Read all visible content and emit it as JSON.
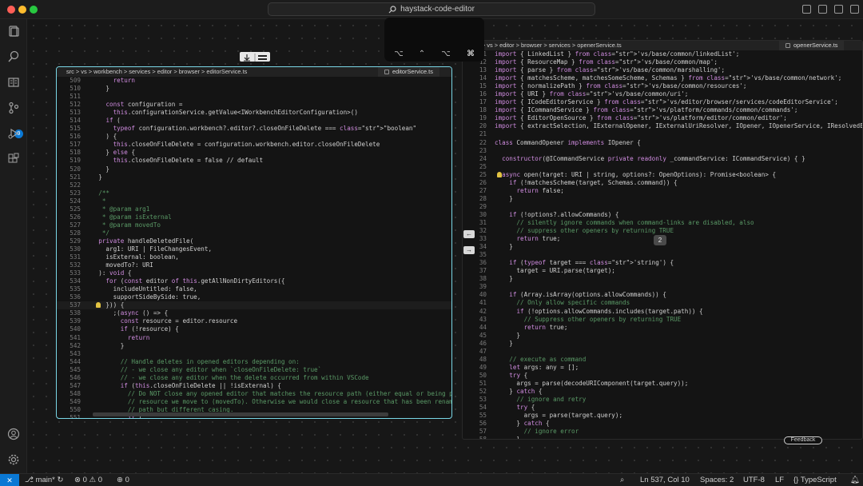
{
  "titlebar": {
    "search_text": "haystack-code-editor"
  },
  "activity": {
    "source_control_badge": "9"
  },
  "left_editor": {
    "breadcrumb": "src > vs > workbench > services > editor > browser > editorService.ts",
    "tab": "editorService.ts",
    "lines": [
      {
        "n": "509",
        "t": "        return"
      },
      {
        "n": "510",
        "t": "      }"
      },
      {
        "n": "511",
        "t": ""
      },
      {
        "n": "512",
        "t": "      const configuration ="
      },
      {
        "n": "513",
        "t": "        this.configurationService.getValue<IWorkbenchEditorConfiguration>()"
      },
      {
        "n": "514",
        "t": "      if ("
      },
      {
        "n": "515",
        "t": "        typeof configuration.workbench?.editor?.closeOnFileDelete === \"boolean\""
      },
      {
        "n": "516",
        "t": "      ) {"
      },
      {
        "n": "517",
        "t": "        this.closeOnFileDelete = configuration.workbench.editor.closeOnFileDelete"
      },
      {
        "n": "518",
        "t": "      } else {"
      },
      {
        "n": "519",
        "t": "        this.closeOnFileDelete = false // default"
      },
      {
        "n": "520",
        "t": "      }"
      },
      {
        "n": "521",
        "t": "    }"
      },
      {
        "n": "522",
        "t": ""
      },
      {
        "n": "523",
        "t": "    /**"
      },
      {
        "n": "524",
        "t": "     *"
      },
      {
        "n": "525",
        "t": "     * @param arg1"
      },
      {
        "n": "526",
        "t": "     * @param isExternal"
      },
      {
        "n": "527",
        "t": "     * @param movedTo"
      },
      {
        "n": "528",
        "t": "     */"
      },
      {
        "n": "529",
        "t": "    private handleDeletedFile("
      },
      {
        "n": "530",
        "t": "      arg1: URI | FileChangesEvent,"
      },
      {
        "n": "531",
        "t": "      isExternal: boolean,"
      },
      {
        "n": "532",
        "t": "      movedTo?: URI"
      },
      {
        "n": "533",
        "t": "    ): void {"
      },
      {
        "n": "534",
        "t": "      for (const editor of this.getAllNonDirtyEditors({"
      },
      {
        "n": "535",
        "t": "        includeUntitled: false,"
      },
      {
        "n": "536",
        "t": "        supportSideBySide: true,"
      },
      {
        "n": "537",
        "t": "      })) {"
      },
      {
        "n": "538",
        "t": "        ;(async () => {"
      },
      {
        "n": "539",
        "t": "          const resource = editor.resource"
      },
      {
        "n": "540",
        "t": "          if (!resource) {"
      },
      {
        "n": "541",
        "t": "            return"
      },
      {
        "n": "542",
        "t": "          }"
      },
      {
        "n": "543",
        "t": ""
      },
      {
        "n": "544",
        "t": "          // Handle deletes in opened editors depending on:"
      },
      {
        "n": "545",
        "t": "          // - we close any editor when `closeOnFileDelete: true`"
      },
      {
        "n": "546",
        "t": "          // - we close any editor when the delete occurred from within VSCode"
      },
      {
        "n": "547",
        "t": "          if (this.closeOnFileDelete || !isExternal) {"
      },
      {
        "n": "548",
        "t": "            // Do NOT close any opened editor that matches the resource path (either equal or being pa"
      },
      {
        "n": "549",
        "t": "            // resource we move to (movedTo). Otherwise we would close a resource that has been rename"
      },
      {
        "n": "550",
        "t": "            // path but different casing."
      },
      {
        "n": "551",
        "t": "            if ("
      }
    ]
  },
  "right_editor": {
    "breadcrumb": "src > vs > editor > browser > services > openerService.ts",
    "tab": "openerService.ts",
    "lines": [
      {
        "n": "11",
        "t": "import { LinkedList } from 'vs/base/common/linkedList';"
      },
      {
        "n": "12",
        "t": "import { ResourceMap } from 'vs/base/common/map';"
      },
      {
        "n": "13",
        "t": "import { parse } from 'vs/base/common/marshalling';"
      },
      {
        "n": "14",
        "t": "import { matchesScheme, matchesSomeScheme, Schemas } from 'vs/base/common/network';"
      },
      {
        "n": "15",
        "t": "import { normalizePath } from 'vs/base/common/resources';"
      },
      {
        "n": "16",
        "t": "import { URI } from 'vs/base/common/uri';"
      },
      {
        "n": "17",
        "t": "import { ICodeEditorService } from 'vs/editor/browser/services/codeEditorService';"
      },
      {
        "n": "18",
        "t": "import { ICommandService } from 'vs/platform/commands/common/commands';"
      },
      {
        "n": "19",
        "t": "import { EditorOpenSource } from 'vs/platform/editor/common/editor';"
      },
      {
        "n": "20",
        "t": "import { extractSelection, IExternalOpener, IExternalUriResolver, IOpener, IOpenerService, IResolvedE"
      },
      {
        "n": "21",
        "t": ""
      },
      {
        "n": "22",
        "t": "class CommandOpener implements IOpener {"
      },
      {
        "n": "23",
        "t": ""
      },
      {
        "n": "24",
        "t": "  constructor(@ICommandService private readonly _commandService: ICommandService) { }"
      },
      {
        "n": "25",
        "t": ""
      },
      {
        "n": "25",
        "t": "  async open(target: URI | string, options?: OpenOptions): Promise<boolean> {"
      },
      {
        "n": "26",
        "t": "    if (!matchesScheme(target, Schemas.command)) {"
      },
      {
        "n": "27",
        "t": "      return false;"
      },
      {
        "n": "28",
        "t": "    }"
      },
      {
        "n": "29",
        "t": ""
      },
      {
        "n": "30",
        "t": "    if (!options?.allowCommands) {"
      },
      {
        "n": "31",
        "t": "      // silently ignore commands when command-links are disabled, also"
      },
      {
        "n": "32",
        "t": "      // suppress other openers by returning TRUE"
      },
      {
        "n": "33",
        "t": "      return true;"
      },
      {
        "n": "34",
        "t": "    }"
      },
      {
        "n": "35",
        "t": ""
      },
      {
        "n": "36",
        "t": "    if (typeof target === 'string') {"
      },
      {
        "n": "37",
        "t": "      target = URI.parse(target);"
      },
      {
        "n": "38",
        "t": "    }"
      },
      {
        "n": "39",
        "t": ""
      },
      {
        "n": "40",
        "t": "    if (Array.isArray(options.allowCommands)) {"
      },
      {
        "n": "41",
        "t": "      // Only allow specific commands"
      },
      {
        "n": "42",
        "t": "      if (!options.allowCommands.includes(target.path)) {"
      },
      {
        "n": "43",
        "t": "        // Suppress other openers by returning TRUE"
      },
      {
        "n": "44",
        "t": "        return true;"
      },
      {
        "n": "45",
        "t": "      }"
      },
      {
        "n": "46",
        "t": "    }"
      },
      {
        "n": "47",
        "t": ""
      },
      {
        "n": "48",
        "t": "    // execute as command"
      },
      {
        "n": "49",
        "t": "    let args: any = [];"
      },
      {
        "n": "50",
        "t": "    try {"
      },
      {
        "n": "51",
        "t": "      args = parse(decodeURIComponent(target.query));"
      },
      {
        "n": "52",
        "t": "    } catch {"
      },
      {
        "n": "53",
        "t": "      // ignore and retry"
      },
      {
        "n": "54",
        "t": "      try {"
      },
      {
        "n": "55",
        "t": "        args = parse(target.query);"
      },
      {
        "n": "56",
        "t": "      } catch {"
      },
      {
        "n": "57",
        "t": "        // ignore error"
      },
      {
        "n": "58",
        "t": "      }"
      }
    ]
  },
  "overlay": {
    "badge_2": "2",
    "feedback_label": "Feedback"
  },
  "status": {
    "remote_icon": "remote-icon",
    "branch": "main*",
    "problems": "0",
    "warnings": "0",
    "ports": "0",
    "cursor": "Ln 537, Col 10",
    "spaces": "Spaces: 2",
    "encoding": "UTF-8",
    "eol": "LF",
    "language": "TypeScript"
  }
}
